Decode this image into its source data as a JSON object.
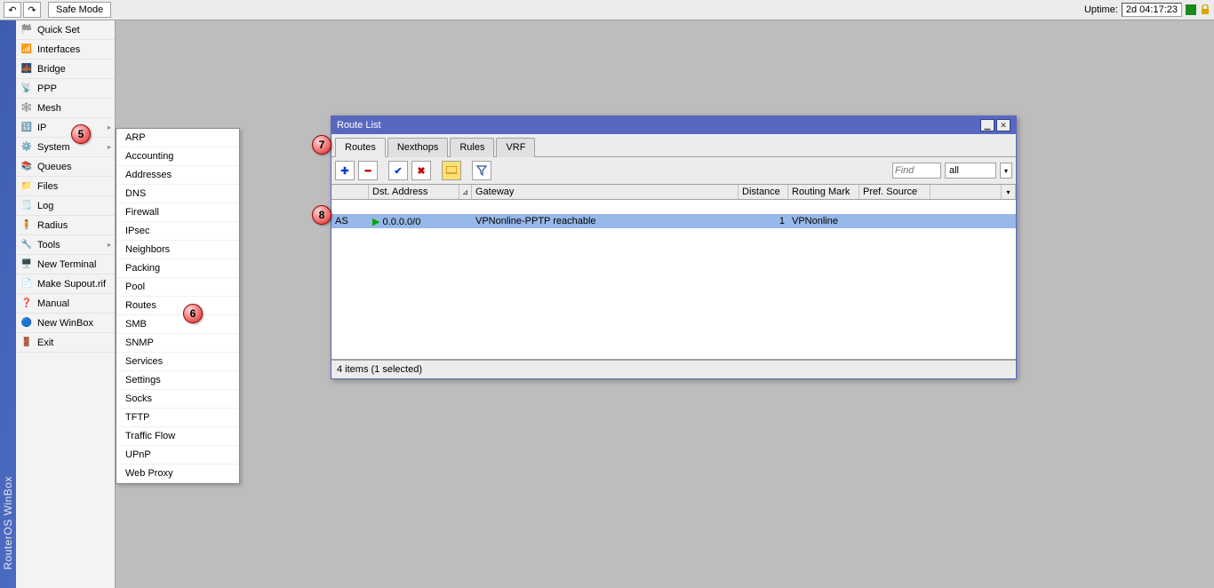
{
  "toolbar": {
    "undo_glyph": "↶",
    "redo_glyph": "↷",
    "safe_mode": "Safe Mode",
    "uptime_label": "Uptime:",
    "uptime_value": "2d 04:17:23"
  },
  "side_title": "RouterOS WinBox",
  "sidebar": [
    {
      "icon": "🏁",
      "label": "Quick Set",
      "sub": false
    },
    {
      "icon": "📶",
      "label": "Interfaces",
      "sub": false
    },
    {
      "icon": "🌉",
      "label": "Bridge",
      "sub": false
    },
    {
      "icon": "📡",
      "label": "PPP",
      "sub": false
    },
    {
      "icon": "🕸️",
      "label": "Mesh",
      "sub": false
    },
    {
      "icon": "🔢",
      "label": "IP",
      "sub": true
    },
    {
      "icon": "⚙️",
      "label": "System",
      "sub": true
    },
    {
      "icon": "📚",
      "label": "Queues",
      "sub": false
    },
    {
      "icon": "📁",
      "label": "Files",
      "sub": false
    },
    {
      "icon": "🗒️",
      "label": "Log",
      "sub": false
    },
    {
      "icon": "🧍",
      "label": "Radius",
      "sub": false
    },
    {
      "icon": "🔧",
      "label": "Tools",
      "sub": true
    },
    {
      "icon": "🖥️",
      "label": "New Terminal",
      "sub": false
    },
    {
      "icon": "📄",
      "label": "Make Supout.rif",
      "sub": false
    },
    {
      "icon": "❓",
      "label": "Manual",
      "sub": false
    },
    {
      "icon": "🔵",
      "label": "New WinBox",
      "sub": false
    },
    {
      "icon": "🚪",
      "label": "Exit",
      "sub": false
    }
  ],
  "submenu": [
    "ARP",
    "Accounting",
    "Addresses",
    "DNS",
    "Firewall",
    "IPsec",
    "Neighbors",
    "Packing",
    "Pool",
    "Routes",
    "SMB",
    "SNMP",
    "Services",
    "Settings",
    "Socks",
    "TFTP",
    "Traffic Flow",
    "UPnP",
    "Web Proxy"
  ],
  "window": {
    "title": "Route List",
    "tabs": [
      "Routes",
      "Nexthops",
      "Rules",
      "VRF"
    ],
    "active_tab": 0,
    "tb_add": "✚",
    "tb_remove": "━",
    "tb_enable": "✔",
    "tb_disable": "✖",
    "tb_comment": "💬",
    "tb_filter": "▼",
    "find_placeholder": "Find",
    "filter_all": "all",
    "columns": [
      "",
      "Dst. Address",
      "",
      "Gateway",
      "Distance",
      "Routing Mark",
      "Pref. Source",
      ""
    ],
    "row": {
      "flags": "AS",
      "tri": "▶",
      "dst": "0.0.0.0/0",
      "gw": "VPNonline-PPTP reachable",
      "distance": "1",
      "mark": "VPNonline",
      "pref": ""
    },
    "status": "4 items (1 selected)"
  },
  "callouts": {
    "5": "5",
    "6": "6",
    "7": "7",
    "8": "8"
  }
}
